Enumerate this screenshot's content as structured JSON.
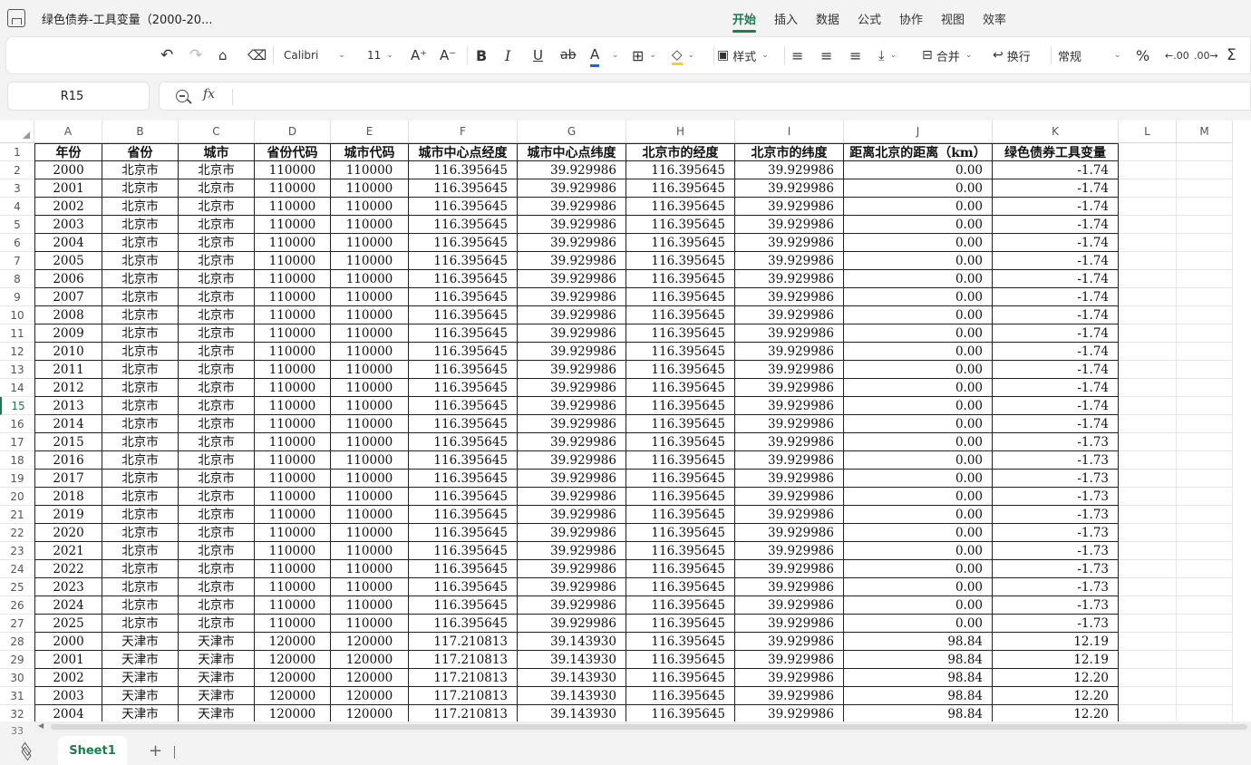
{
  "titlebar": {
    "doc_title": "绿色债券-工具变量（2000-20...",
    "menu": [
      "开始",
      "插入",
      "数据",
      "公式",
      "协作",
      "视图",
      "效率"
    ]
  },
  "toolbar": {
    "font_name": "Calibri",
    "font_size": "11",
    "style_label": "样式",
    "merge_label": "合并",
    "wrap_label": "换行",
    "format_label": "常规",
    "percent": "%",
    "sum": "Σ",
    "bold": "B",
    "italic": "I",
    "underline": "U",
    "strike": "ab",
    "font_color": "A",
    "grow": "A⁺",
    "shrink": "A⁻"
  },
  "formula": {
    "cell_ref": "R15",
    "fx": "fx",
    "content": ""
  },
  "grid": {
    "columns": [
      "A",
      "B",
      "C",
      "D",
      "E",
      "F",
      "G",
      "H",
      "I",
      "J",
      "K",
      "L",
      "M"
    ],
    "headers": [
      "年份",
      "省份",
      "城市",
      "省份代码",
      "城市代码",
      "城市中心点经度",
      "城市中心点纬度",
      "北京市的经度",
      "北京市的纬度",
      "距离北京的距离（km）",
      "绿色债券工具变量"
    ],
    "rows": [
      [
        "2000",
        "北京市",
        "北京市",
        "110000",
        "110000",
        "116.395645",
        "39.929986",
        "116.395645",
        "39.929986",
        "0.00",
        "-1.74"
      ],
      [
        "2001",
        "北京市",
        "北京市",
        "110000",
        "110000",
        "116.395645",
        "39.929986",
        "116.395645",
        "39.929986",
        "0.00",
        "-1.74"
      ],
      [
        "2002",
        "北京市",
        "北京市",
        "110000",
        "110000",
        "116.395645",
        "39.929986",
        "116.395645",
        "39.929986",
        "0.00",
        "-1.74"
      ],
      [
        "2003",
        "北京市",
        "北京市",
        "110000",
        "110000",
        "116.395645",
        "39.929986",
        "116.395645",
        "39.929986",
        "0.00",
        "-1.74"
      ],
      [
        "2004",
        "北京市",
        "北京市",
        "110000",
        "110000",
        "116.395645",
        "39.929986",
        "116.395645",
        "39.929986",
        "0.00",
        "-1.74"
      ],
      [
        "2005",
        "北京市",
        "北京市",
        "110000",
        "110000",
        "116.395645",
        "39.929986",
        "116.395645",
        "39.929986",
        "0.00",
        "-1.74"
      ],
      [
        "2006",
        "北京市",
        "北京市",
        "110000",
        "110000",
        "116.395645",
        "39.929986",
        "116.395645",
        "39.929986",
        "0.00",
        "-1.74"
      ],
      [
        "2007",
        "北京市",
        "北京市",
        "110000",
        "110000",
        "116.395645",
        "39.929986",
        "116.395645",
        "39.929986",
        "0.00",
        "-1.74"
      ],
      [
        "2008",
        "北京市",
        "北京市",
        "110000",
        "110000",
        "116.395645",
        "39.929986",
        "116.395645",
        "39.929986",
        "0.00",
        "-1.74"
      ],
      [
        "2009",
        "北京市",
        "北京市",
        "110000",
        "110000",
        "116.395645",
        "39.929986",
        "116.395645",
        "39.929986",
        "0.00",
        "-1.74"
      ],
      [
        "2010",
        "北京市",
        "北京市",
        "110000",
        "110000",
        "116.395645",
        "39.929986",
        "116.395645",
        "39.929986",
        "0.00",
        "-1.74"
      ],
      [
        "2011",
        "北京市",
        "北京市",
        "110000",
        "110000",
        "116.395645",
        "39.929986",
        "116.395645",
        "39.929986",
        "0.00",
        "-1.74"
      ],
      [
        "2012",
        "北京市",
        "北京市",
        "110000",
        "110000",
        "116.395645",
        "39.929986",
        "116.395645",
        "39.929986",
        "0.00",
        "-1.74"
      ],
      [
        "2013",
        "北京市",
        "北京市",
        "110000",
        "110000",
        "116.395645",
        "39.929986",
        "116.395645",
        "39.929986",
        "0.00",
        "-1.74"
      ],
      [
        "2014",
        "北京市",
        "北京市",
        "110000",
        "110000",
        "116.395645",
        "39.929986",
        "116.395645",
        "39.929986",
        "0.00",
        "-1.74"
      ],
      [
        "2015",
        "北京市",
        "北京市",
        "110000",
        "110000",
        "116.395645",
        "39.929986",
        "116.395645",
        "39.929986",
        "0.00",
        "-1.73"
      ],
      [
        "2016",
        "北京市",
        "北京市",
        "110000",
        "110000",
        "116.395645",
        "39.929986",
        "116.395645",
        "39.929986",
        "0.00",
        "-1.73"
      ],
      [
        "2017",
        "北京市",
        "北京市",
        "110000",
        "110000",
        "116.395645",
        "39.929986",
        "116.395645",
        "39.929986",
        "0.00",
        "-1.73"
      ],
      [
        "2018",
        "北京市",
        "北京市",
        "110000",
        "110000",
        "116.395645",
        "39.929986",
        "116.395645",
        "39.929986",
        "0.00",
        "-1.73"
      ],
      [
        "2019",
        "北京市",
        "北京市",
        "110000",
        "110000",
        "116.395645",
        "39.929986",
        "116.395645",
        "39.929986",
        "0.00",
        "-1.73"
      ],
      [
        "2020",
        "北京市",
        "北京市",
        "110000",
        "110000",
        "116.395645",
        "39.929986",
        "116.395645",
        "39.929986",
        "0.00",
        "-1.73"
      ],
      [
        "2021",
        "北京市",
        "北京市",
        "110000",
        "110000",
        "116.395645",
        "39.929986",
        "116.395645",
        "39.929986",
        "0.00",
        "-1.73"
      ],
      [
        "2022",
        "北京市",
        "北京市",
        "110000",
        "110000",
        "116.395645",
        "39.929986",
        "116.395645",
        "39.929986",
        "0.00",
        "-1.73"
      ],
      [
        "2023",
        "北京市",
        "北京市",
        "110000",
        "110000",
        "116.395645",
        "39.929986",
        "116.395645",
        "39.929986",
        "0.00",
        "-1.73"
      ],
      [
        "2024",
        "北京市",
        "北京市",
        "110000",
        "110000",
        "116.395645",
        "39.929986",
        "116.395645",
        "39.929986",
        "0.00",
        "-1.73"
      ],
      [
        "2025",
        "北京市",
        "北京市",
        "110000",
        "110000",
        "116.395645",
        "39.929986",
        "116.395645",
        "39.929986",
        "0.00",
        "-1.73"
      ],
      [
        "2000",
        "天津市",
        "天津市",
        "120000",
        "120000",
        "117.210813",
        "39.143930",
        "116.395645",
        "39.929986",
        "98.84",
        "12.19"
      ],
      [
        "2001",
        "天津市",
        "天津市",
        "120000",
        "120000",
        "117.210813",
        "39.143930",
        "116.395645",
        "39.929986",
        "98.84",
        "12.19"
      ],
      [
        "2002",
        "天津市",
        "天津市",
        "120000",
        "120000",
        "117.210813",
        "39.143930",
        "116.395645",
        "39.929986",
        "98.84",
        "12.20"
      ],
      [
        "2003",
        "天津市",
        "天津市",
        "120000",
        "120000",
        "117.210813",
        "39.143930",
        "116.395645",
        "39.929986",
        "98.84",
        "12.20"
      ],
      [
        "2004",
        "天津市",
        "天津市",
        "120000",
        "120000",
        "117.210813",
        "39.143930",
        "116.395645",
        "39.929986",
        "98.84",
        "12.20"
      ]
    ],
    "selected_row": 15,
    "next_row_label": "33"
  },
  "tabs": {
    "sheets": [
      "Sheet1"
    ],
    "add": "+"
  },
  "colors": {
    "accent": "#1c7c4c"
  }
}
